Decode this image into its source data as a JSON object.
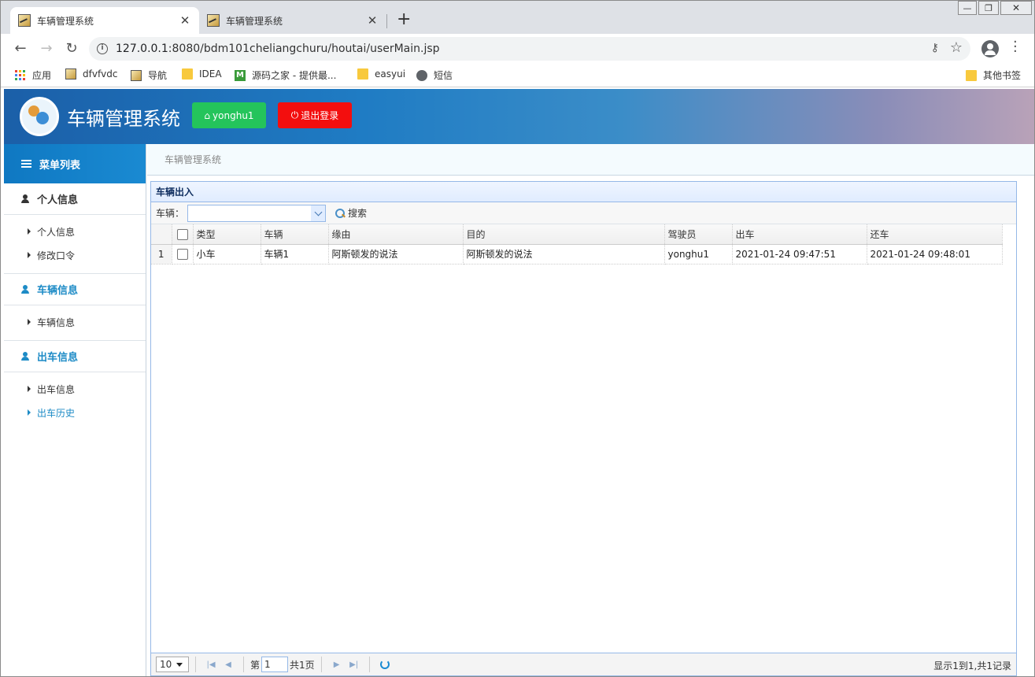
{
  "browser": {
    "tabs": [
      {
        "title": "车辆管理系统",
        "active": true
      },
      {
        "title": "车辆管理系统",
        "active": false
      }
    ],
    "url_host": "127.0.0.1",
    "url_rest": ":8080/bdm101cheliangchuru/houtai/userMain.jsp",
    "bookmarks": [
      "应用",
      "dfvfvdc",
      "导航",
      "IDEA",
      "源码之家 - 提供最...",
      "easyui",
      "短信"
    ],
    "other_bookmarks": "其他书签"
  },
  "app": {
    "title": "车辆管理系统",
    "user_button": "yonghu1",
    "logout_button": "退出登录"
  },
  "sidebar": {
    "header": "菜单列表",
    "groups": [
      {
        "label": "个人信息",
        "items": [
          "个人信息",
          "修改口令"
        ]
      },
      {
        "label": "车辆信息",
        "items": [
          "车辆信息"
        ]
      },
      {
        "label": "出车信息",
        "items": [
          "出车信息",
          "出车历史"
        ]
      }
    ],
    "selected_item": "出车历史"
  },
  "breadcrumb": "车辆管理系统",
  "panel": {
    "title": "车辆出入",
    "search_label": "车辆：",
    "search_value": "",
    "search_button": "搜索"
  },
  "table": {
    "columns": [
      "类型",
      "车辆",
      "缘由",
      "目的",
      "驾驶员",
      "出车",
      "还车"
    ],
    "rows": [
      {
        "num": "1",
        "cells": [
          "小车",
          "车辆1",
          "阿斯顿发的说法",
          "阿斯顿发的说法",
          "yonghu1",
          "2021-01-24 09:47:51",
          "2021-01-24 09:48:01"
        ]
      }
    ]
  },
  "pager": {
    "page_size": "10",
    "page_prefix": "第",
    "page_value": "1",
    "page_suffix": "共1页",
    "info": "显示1到1,共1记录"
  },
  "colors": {
    "accent": "#1d8bc6",
    "user_button": "#24c45b",
    "logout_button": "#f30e0e",
    "panel_border": "#95b8e7"
  }
}
